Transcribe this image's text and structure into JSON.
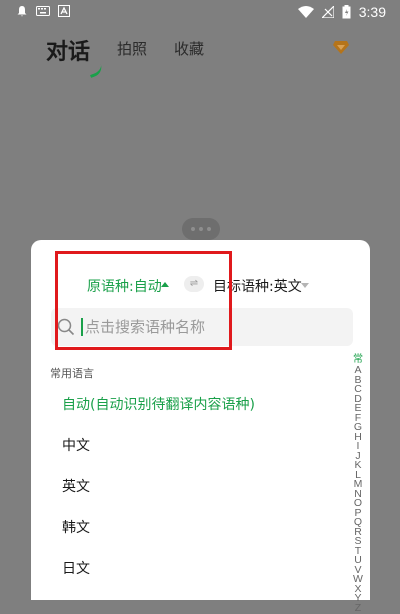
{
  "status_bar": {
    "time": "3:39",
    "left_icons": [
      "notification-bell-icon",
      "keyboard-icon",
      "app-a-icon"
    ],
    "right_icons": [
      "wifi-icon",
      "no-signal-icon",
      "battery-icon"
    ]
  },
  "header": {
    "title": "对话",
    "tabs": [
      {
        "label": "拍照"
      },
      {
        "label": "收藏"
      }
    ],
    "vip_icon": "diamond-icon"
  },
  "sheet": {
    "source_language": "原语种:自动",
    "target_language": "目标语种:英文",
    "swap_icon": "swap-icon",
    "search": {
      "placeholder": "点击搜索语种名称",
      "value": ""
    },
    "section_title": "常用语言",
    "languages": [
      {
        "label": "自动(自动识别待翻译内容语种)",
        "selected": true
      },
      {
        "label": "中文",
        "selected": false
      },
      {
        "label": "英文",
        "selected": false
      },
      {
        "label": "韩文",
        "selected": false
      },
      {
        "label": "日文",
        "selected": false
      }
    ],
    "index_letters": [
      "常",
      "A",
      "B",
      "C",
      "D",
      "E",
      "F",
      "G",
      "H",
      "I",
      "J",
      "K",
      "L",
      "M",
      "N",
      "O",
      "P",
      "Q",
      "R",
      "S",
      "T",
      "U",
      "V",
      "W",
      "X",
      "Y",
      "Z"
    ]
  },
  "colors": {
    "accent": "#1aa04a",
    "overlay": "#7f7f7f",
    "highlight": "#e0191c"
  }
}
